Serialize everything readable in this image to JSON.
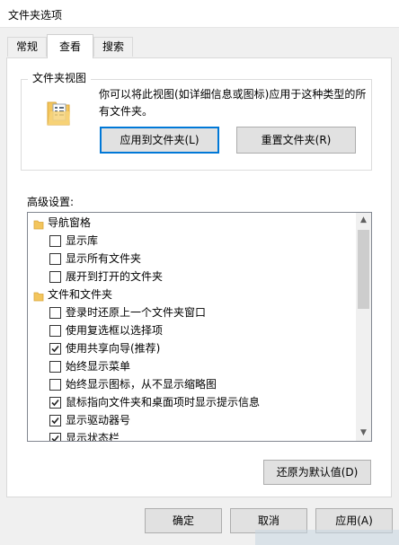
{
  "window": {
    "title": "文件夹选项"
  },
  "tabs": [
    {
      "label": "常规"
    },
    {
      "label": "查看"
    },
    {
      "label": "搜索"
    }
  ],
  "folder_views": {
    "legend": "文件夹视图",
    "description": "你可以将此视图(如详细信息或图标)应用于这种类型的所有文件夹。",
    "apply_button": "应用到文件夹(L)",
    "reset_button": "重置文件夹(R)"
  },
  "advanced": {
    "label": "高级设置:",
    "items": [
      {
        "type": "category",
        "label": "导航窗格"
      },
      {
        "type": "checkbox",
        "label": "显示库",
        "checked": false
      },
      {
        "type": "checkbox",
        "label": "显示所有文件夹",
        "checked": false
      },
      {
        "type": "checkbox",
        "label": "展开到打开的文件夹",
        "checked": false
      },
      {
        "type": "category",
        "label": "文件和文件夹"
      },
      {
        "type": "checkbox",
        "label": "登录时还原上一个文件夹窗口",
        "checked": false
      },
      {
        "type": "checkbox",
        "label": "使用复选框以选择项",
        "checked": false
      },
      {
        "type": "checkbox",
        "label": "使用共享向导(推荐)",
        "checked": true
      },
      {
        "type": "checkbox",
        "label": "始终显示菜单",
        "checked": false
      },
      {
        "type": "checkbox",
        "label": "始终显示图标，从不显示缩略图",
        "checked": false
      },
      {
        "type": "checkbox",
        "label": "鼠标指向文件夹和桌面项时显示提示信息",
        "checked": true
      },
      {
        "type": "checkbox",
        "label": "显示驱动器号",
        "checked": true
      },
      {
        "type": "checkbox",
        "label": "显示状态栏",
        "checked": true
      }
    ],
    "restore_button": "还原为默认值(D)"
  },
  "footer": {
    "ok": "确定",
    "cancel": "取消",
    "apply": "应用(A)"
  },
  "colors": {
    "accent": "#0078d7",
    "folder": "#f3c55c"
  },
  "icons": {
    "folder_view": "folder-document-icon",
    "category": "folder-icon",
    "check": "checkmark-icon"
  }
}
